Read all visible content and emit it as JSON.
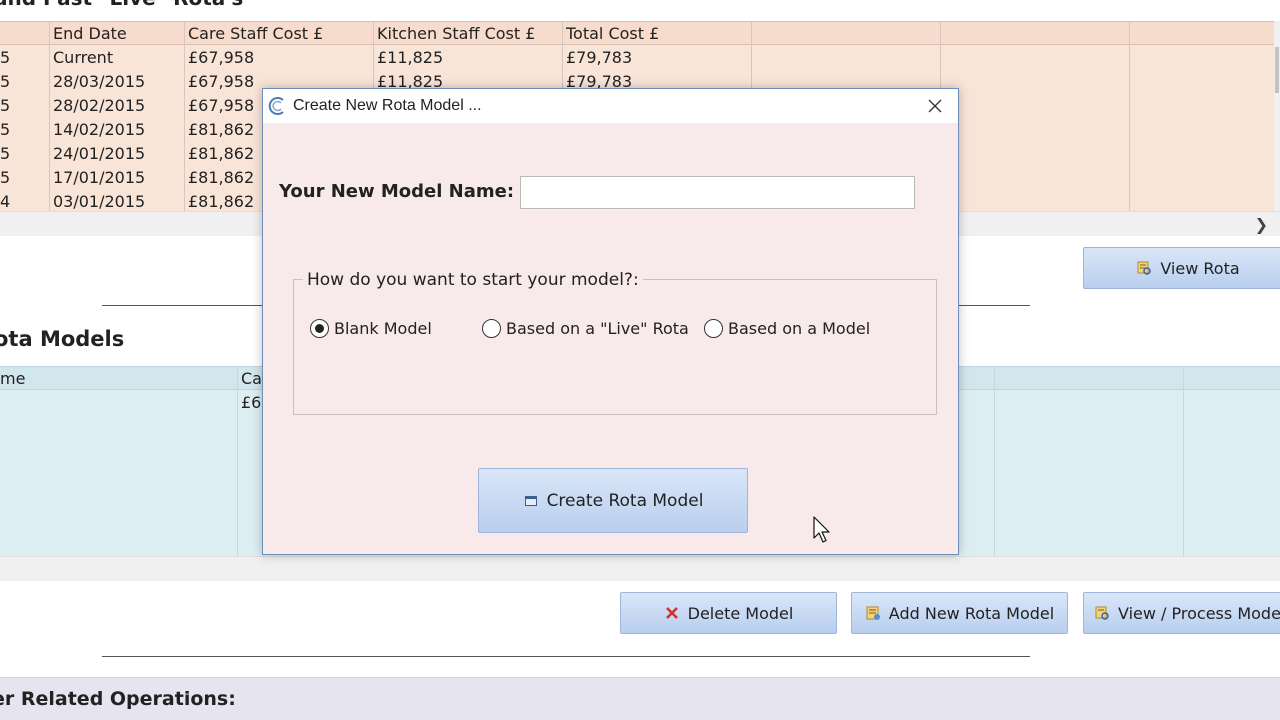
{
  "top_section": {
    "title": "and Past \"Live\" Rota's",
    "columns": [
      "End Date",
      "Care Staff Cost £",
      "Kitchen Staff Cost £",
      "Total Cost £"
    ],
    "rows": [
      {
        "prefix": "5",
        "end_date": "Current",
        "care": "£67,958",
        "kitchen": "£11,825",
        "total": "£79,783"
      },
      {
        "prefix": "5",
        "end_date": "28/03/2015",
        "care": "£67,958",
        "kitchen": "£11,825",
        "total": "£79,783"
      },
      {
        "prefix": "5",
        "end_date": "28/02/2015",
        "care": "£67,958",
        "kitchen": "",
        "total": ""
      },
      {
        "prefix": "5",
        "end_date": "14/02/2015",
        "care": "£81,862",
        "kitchen": "",
        "total": ""
      },
      {
        "prefix": "5",
        "end_date": "24/01/2015",
        "care": "£81,862",
        "kitchen": "",
        "total": ""
      },
      {
        "prefix": "5",
        "end_date": "17/01/2015",
        "care": "£81,862",
        "kitchen": "",
        "total": ""
      },
      {
        "prefix": "4",
        "end_date": "03/01/2015",
        "care": "£81,862",
        "kitchen": "",
        "total": ""
      }
    ],
    "view_rota_label": "View Rota"
  },
  "models_section": {
    "title": "ota Models",
    "columns": [
      "me",
      "Ca"
    ],
    "first_row_value": "£6"
  },
  "buttons": {
    "delete_model": "Delete Model",
    "add_new_rota_model": "Add New Rota Model",
    "view_process_model": "View / Process Mode"
  },
  "operations_title": "er Related Operations:",
  "dialog": {
    "title": "Create New Rota Model ...",
    "name_label": "Your New Model Name:",
    "name_value": "",
    "group_label": "How do you want to start your model?:",
    "options": [
      {
        "label": "Blank Model",
        "selected": true
      },
      {
        "label": "Based on a \"Live\" Rota",
        "selected": false
      },
      {
        "label": "Based on a Model",
        "selected": false
      }
    ],
    "create_button": "Create Rota Model"
  },
  "colors": {
    "top_table_bg": "#f9e4d8",
    "models_table_bg": "#ddeef3",
    "dialog_bg": "#f8e9ea",
    "button_gradient_top": "#d9e6f8",
    "button_gradient_bottom": "#b9cfee"
  }
}
